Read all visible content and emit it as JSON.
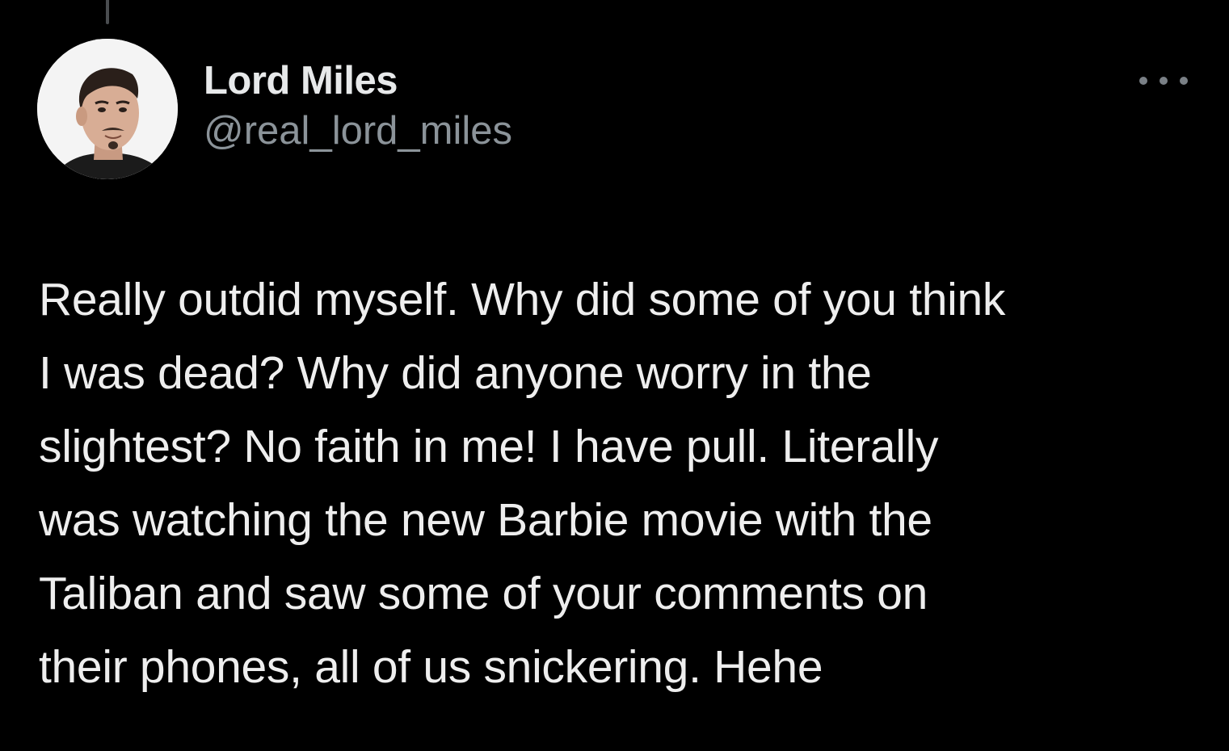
{
  "tweet": {
    "author": {
      "display_name": "Lord Miles",
      "handle": "@real_lord_miles",
      "avatar_icon": "user-avatar-photo"
    },
    "more_icon": "more-options-icon",
    "text_lines": [
      "Really outdid myself. Why did some of you think",
      "I was dead? Why did anyone worry in the",
      "slightest? No faith in me! I have pull. Literally",
      "was watching the new Barbie movie with the",
      "Taliban and saw some of your comments on",
      "their phones, all of us snickering. Hehe"
    ]
  },
  "colors": {
    "background": "#000000",
    "primary_text": "#e7e9ea",
    "secondary_text": "#8b9399"
  }
}
